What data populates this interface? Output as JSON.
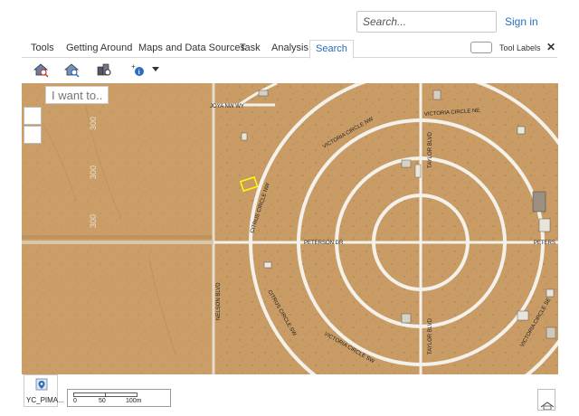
{
  "header": {
    "search_placeholder": "Search...",
    "signin_label": "Sign in"
  },
  "tabs": [
    {
      "label": "Tools"
    },
    {
      "label": "Getting Around"
    },
    {
      "label": "Maps and Data Sources"
    },
    {
      "label": "Task"
    },
    {
      "label": "Analysis"
    },
    {
      "label": "Search",
      "active": true
    }
  ],
  "tool_labels_toggle": {
    "label": "Tool Labels"
  },
  "toolbar": {
    "icons": [
      "house-search-icon",
      "house-search-alt-icon",
      "buildings-search-icon",
      "info-add-icon",
      "dropdown-caret-icon"
    ]
  },
  "map": {
    "iwant_placeholder": "I want to...",
    "street_labels": {
      "joya": "JOYA NW WY",
      "victoria_ne": "VICTORIA CIRCLE NE",
      "victoria_nw": "VICTORIA CIRCLE NW",
      "citrus_nw": "CITRUS CIRCLE NW",
      "taylor_n": "TAYLOR BLVD",
      "peterson": "PETERSON DR",
      "peterson_e": "PETERS",
      "nelson": "NELSON BLVD",
      "citrus_sw": "CITRUS CIRCLE SW",
      "victoria_sw": "VICTORIA CIRCLE SW",
      "taylor_s": "TAYLOR BLVD",
      "victoria_se": "VICTORIA CIRCLE SE"
    },
    "parcel_numbers": [
      "300",
      "300",
      "300"
    ],
    "colors": {
      "ground": "#c99b65",
      "road": "#f4f1ea",
      "selection": "#ffff00"
    }
  },
  "legend": {
    "label": "YC_PIMA..."
  },
  "scale": {
    "ticks": [
      "0",
      "50",
      "100m"
    ]
  }
}
